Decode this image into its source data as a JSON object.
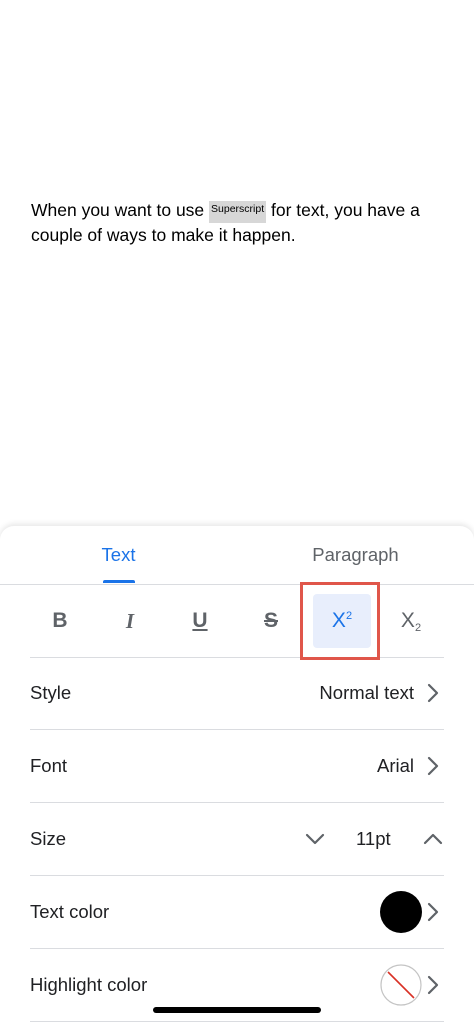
{
  "document": {
    "text_before": "When you want to use ",
    "superscript_word": "Superscript",
    "text_after": " for text, you have a couple of ways to make it happen."
  },
  "tabs": {
    "text": "Text",
    "paragraph": "Paragraph"
  },
  "format_buttons": {
    "bold": "B",
    "italic": "I",
    "underline": "U",
    "strikethrough": "S",
    "superscript_base": "X",
    "superscript_mark": "2",
    "subscript_base": "X",
    "subscript_mark": "2"
  },
  "rows": {
    "style_label": "Style",
    "style_value": "Normal text",
    "font_label": "Font",
    "font_value": "Arial",
    "size_label": "Size",
    "size_value": "11pt",
    "text_color_label": "Text color",
    "highlight_color_label": "Highlight color"
  },
  "icons": {
    "chevron_right": "chevron-right-icon",
    "chevron_down": "chevron-down-icon",
    "chevron_up": "chevron-up-icon"
  },
  "colors": {
    "accent": "#1a73e8",
    "selected_bg": "#e8eefc",
    "highlight_outline": "#e0564a",
    "text_color_swatch": "#000000"
  },
  "state": {
    "active_tab": "Text",
    "superscript_active": true
  }
}
